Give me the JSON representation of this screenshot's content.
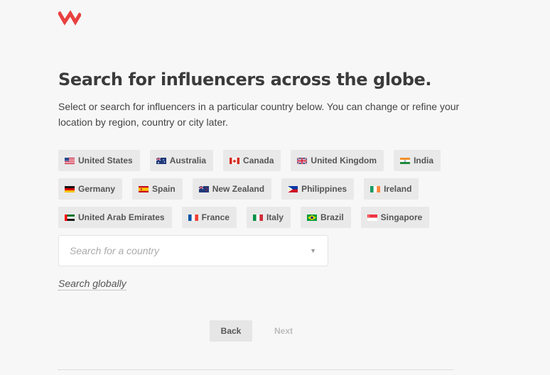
{
  "brand": {
    "accent": "#e8413f"
  },
  "page": {
    "title": "Search for influencers across the globe.",
    "subtitle": "Select or search for influencers in a particular country below. You can change or refine your location by region, country or city later."
  },
  "countries": [
    {
      "label": "United States",
      "flag": "flag-us-icon"
    },
    {
      "label": "Australia",
      "flag": "flag-au-icon"
    },
    {
      "label": "Canada",
      "flag": "flag-ca-icon"
    },
    {
      "label": "United Kingdom",
      "flag": "flag-gb-icon"
    },
    {
      "label": "India",
      "flag": "flag-in-icon"
    },
    {
      "label": "Germany",
      "flag": "flag-de-icon"
    },
    {
      "label": "Spain",
      "flag": "flag-es-icon"
    },
    {
      "label": "New Zealand",
      "flag": "flag-nz-icon"
    },
    {
      "label": "Philippines",
      "flag": "flag-ph-icon"
    },
    {
      "label": "Ireland",
      "flag": "flag-ie-icon"
    },
    {
      "label": "United Arab Emirates",
      "flag": "flag-ae-icon"
    },
    {
      "label": "France",
      "flag": "flag-fr-icon"
    },
    {
      "label": "Italy",
      "flag": "flag-it-icon"
    },
    {
      "label": "Brazil",
      "flag": "flag-br-icon"
    },
    {
      "label": "Singapore",
      "flag": "flag-sg-icon"
    }
  ],
  "search": {
    "placeholder": "Search for a country",
    "value": ""
  },
  "global_link": "Search globally",
  "buttons": {
    "back": "Back",
    "next": "Next"
  }
}
